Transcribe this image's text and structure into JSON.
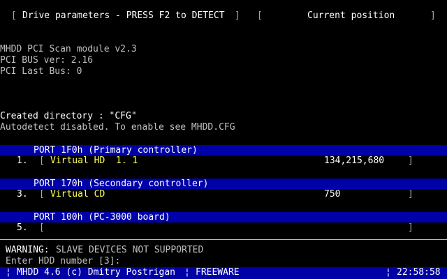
{
  "header": {
    "bracket_open_1": "[",
    "drive_params": "Drive parameters - PRESS F2 to DETECT",
    "bracket_close_1": "]",
    "bracket_open_2": "[",
    "current_position": "Current position",
    "bracket_close_2": "]"
  },
  "log": {
    "line1": "MHDD PCI Scan module v2.3",
    "line2": "PCI BUS ver: 2.16",
    "line3": "PCI Last Bus: 0",
    "line4": "Created directory : \"CFG\"",
    "line5": "Autodetect disabled. To enable see MHDD.CFG"
  },
  "ports": [
    {
      "header": "PORT 1F0h (Primary controller)",
      "number": "1.",
      "device": "Virtual HD  1. 1",
      "size": "134,215,680",
      "open": "[",
      "close": "]"
    },
    {
      "header": "PORT 170h (Secondary controller)",
      "number": "3.",
      "device": "Virtual CD",
      "size": "750",
      "open": "[",
      "close": "]"
    },
    {
      "header": "PORT 100h (PC-3000 board)",
      "number": "5.",
      "device": "",
      "size": "",
      "open": "[",
      "close": "]"
    }
  ],
  "warning": {
    "label": "WARNING:",
    "text": "SLAVE DEVICES NOT SUPPORTED"
  },
  "prompt": {
    "text": "Enter HDD number [3]:"
  },
  "status": {
    "left_sep": "¦",
    "title": "MHDD 4.6 (c) Dmitry Postrigan",
    "mid_sep": "¦",
    "license": "FREEWARE",
    "right_sep": "¦",
    "clock": "22:58:58"
  },
  "colors": {
    "background": "#000000",
    "bar": "#0000a8",
    "highlight": "#ffff55",
    "text": "#c0c0c0"
  }
}
